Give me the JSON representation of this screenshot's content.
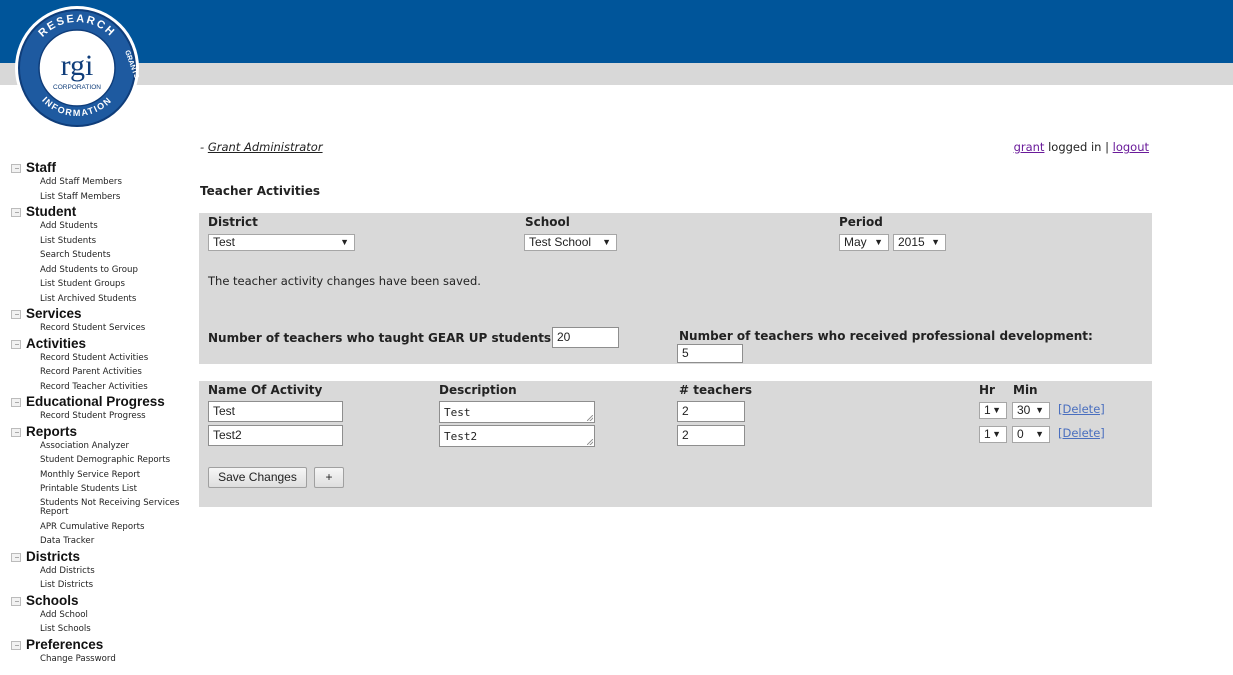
{
  "logo": {
    "ring_top": "RESEARCH",
    "ring_right": "GRANTS",
    "ring_bottom": "INFORMATION",
    "center": "rgi",
    "center_sub": "CORPORATION",
    "brand_color": "#00559a"
  },
  "sidebar": {
    "sections": [
      {
        "title": "Staff",
        "items": [
          "Add Staff Members",
          "List Staff Members"
        ]
      },
      {
        "title": "Student",
        "items": [
          "Add Students",
          "List Students",
          "Search Students",
          "Add Students to Group",
          "List Student Groups",
          "List Archived Students"
        ]
      },
      {
        "title": "Services",
        "items": [
          "Record Student Services"
        ]
      },
      {
        "title": "Activities",
        "items": [
          "Record Student Activities",
          "Record Parent Activities",
          "Record Teacher Activities"
        ]
      },
      {
        "title": "Educational Progress",
        "items": [
          "Record Student Progress"
        ]
      },
      {
        "title": "Reports",
        "items": [
          "Association Analyzer",
          "Student Demographic Reports",
          "Monthly Service Report",
          "Printable Students List",
          "Students Not Receiving Services Report",
          "APR Cumulative Reports",
          "Data Tracker"
        ]
      },
      {
        "title": "Districts",
        "items": [
          "Add Districts",
          "List Districts"
        ]
      },
      {
        "title": "Schools",
        "items": [
          "Add School",
          "List Schools"
        ]
      },
      {
        "title": "Preferences",
        "items": [
          "Change Password"
        ]
      }
    ]
  },
  "userbar": {
    "role_prefix": "- ",
    "role": "Grant Administrator",
    "username": "grant",
    "logged_in_text": " logged in | ",
    "logout": "logout"
  },
  "page": {
    "title": "Teacher Activities"
  },
  "filters": {
    "district_label": "District",
    "school_label": "School",
    "period_label": "Period",
    "district_value": "Test",
    "school_value": "Test School",
    "month_value": "May",
    "year_value": "2015"
  },
  "message": "The teacher activity changes have been saved.",
  "counts": {
    "taught_label": "Number of teachers who taught GEAR UP students:",
    "taught_value": "20",
    "pd_label": "Number of teachers who received professional development:",
    "pd_value": "5"
  },
  "table": {
    "headers": {
      "name": "Name Of Activity",
      "description": "Description",
      "teachers": "# teachers",
      "hr": "Hr",
      "min": "Min"
    },
    "rows": [
      {
        "name": "Test",
        "description": "Test",
        "teachers": "2",
        "hr": "1",
        "min": "30",
        "delete": "[Delete]"
      },
      {
        "name": "Test2",
        "description": "Test2",
        "teachers": "2",
        "hr": "1",
        "min": "0",
        "delete": "[Delete]"
      }
    ]
  },
  "buttons": {
    "save": "Save Changes",
    "add": "+"
  }
}
